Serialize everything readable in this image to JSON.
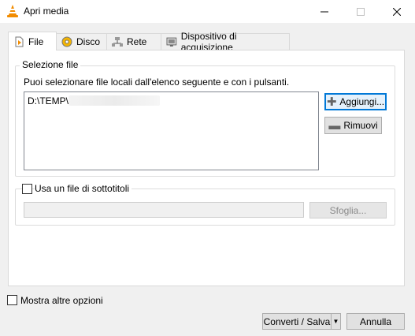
{
  "window": {
    "title": "Apri media"
  },
  "tabs": [
    {
      "label": "File",
      "icon": "file-icon"
    },
    {
      "label": "Disco",
      "icon": "disc-icon"
    },
    {
      "label": "Rete",
      "icon": "network-icon"
    },
    {
      "label": "Dispositivo di acquisizione",
      "icon": "capture-device-icon"
    }
  ],
  "file_selection": {
    "group_label": "Selezione file",
    "description": "Puoi selezionare file locali dall'elenco seguente e con i pulsanti.",
    "items": [
      "D:\\TEMP\\"
    ],
    "add_label": "Aggiungi...",
    "remove_label": "Rimuovi"
  },
  "subtitles": {
    "checkbox_label": "Usa un file di sottotitoli",
    "checked": false,
    "path_value": "",
    "browse_label": "Sfoglia..."
  },
  "footer": {
    "more_options_label": "Mostra altre opzioni",
    "convert_label": "Converti / Salva",
    "cancel_label": "Annulla"
  },
  "colors": {
    "accent": "#0078d7",
    "vlc_orange": "#f28c00"
  }
}
